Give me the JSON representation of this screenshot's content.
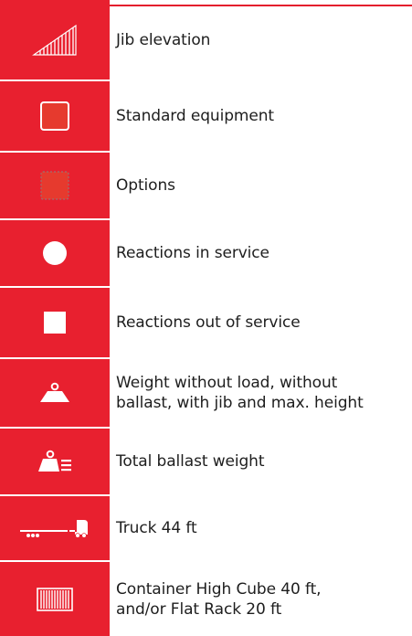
{
  "colors": {
    "icon_background": "#e8202f",
    "accent_rule": "#e41e2d",
    "text": "#1e1e1e"
  },
  "legend": {
    "items": [
      {
        "icon": "jib-elevation-icon",
        "label": "Jib elevation"
      },
      {
        "icon": "standard-equipment-icon",
        "label": "Standard equipment"
      },
      {
        "icon": "options-icon",
        "label": "Options"
      },
      {
        "icon": "reactions-in-service-icon",
        "label": "Reactions in service"
      },
      {
        "icon": "reactions-out-of-service-icon",
        "label": "Reactions out of service"
      },
      {
        "icon": "weight-icon",
        "label": "Weight without load, without\nballast, with jib and max. height"
      },
      {
        "icon": "ballast-weight-icon",
        "label": "Total ballast weight"
      },
      {
        "icon": "truck-icon",
        "label": "Truck 44 ft"
      },
      {
        "icon": "container-icon",
        "label": "Container High Cube 40 ft,\nand/or Flat Rack 20 ft"
      }
    ]
  }
}
